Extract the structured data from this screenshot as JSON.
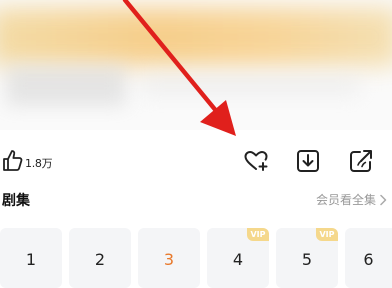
{
  "actions": {
    "like_count": "1.8万"
  },
  "episodes_section": {
    "title": "剧集",
    "see_all": "会员看全集"
  },
  "episodes": [
    {
      "label": "1",
      "vip": ""
    },
    {
      "label": "2",
      "vip": ""
    },
    {
      "label": "3",
      "vip": ""
    },
    {
      "label": "4",
      "vip": "VIP"
    },
    {
      "label": "5",
      "vip": "VIP"
    },
    {
      "label": "6",
      "vip": ""
    }
  ],
  "colors": {
    "accent": "#e8792c",
    "vip_badge": "#f5d88c",
    "annotation_arrow": "#e0201c"
  }
}
